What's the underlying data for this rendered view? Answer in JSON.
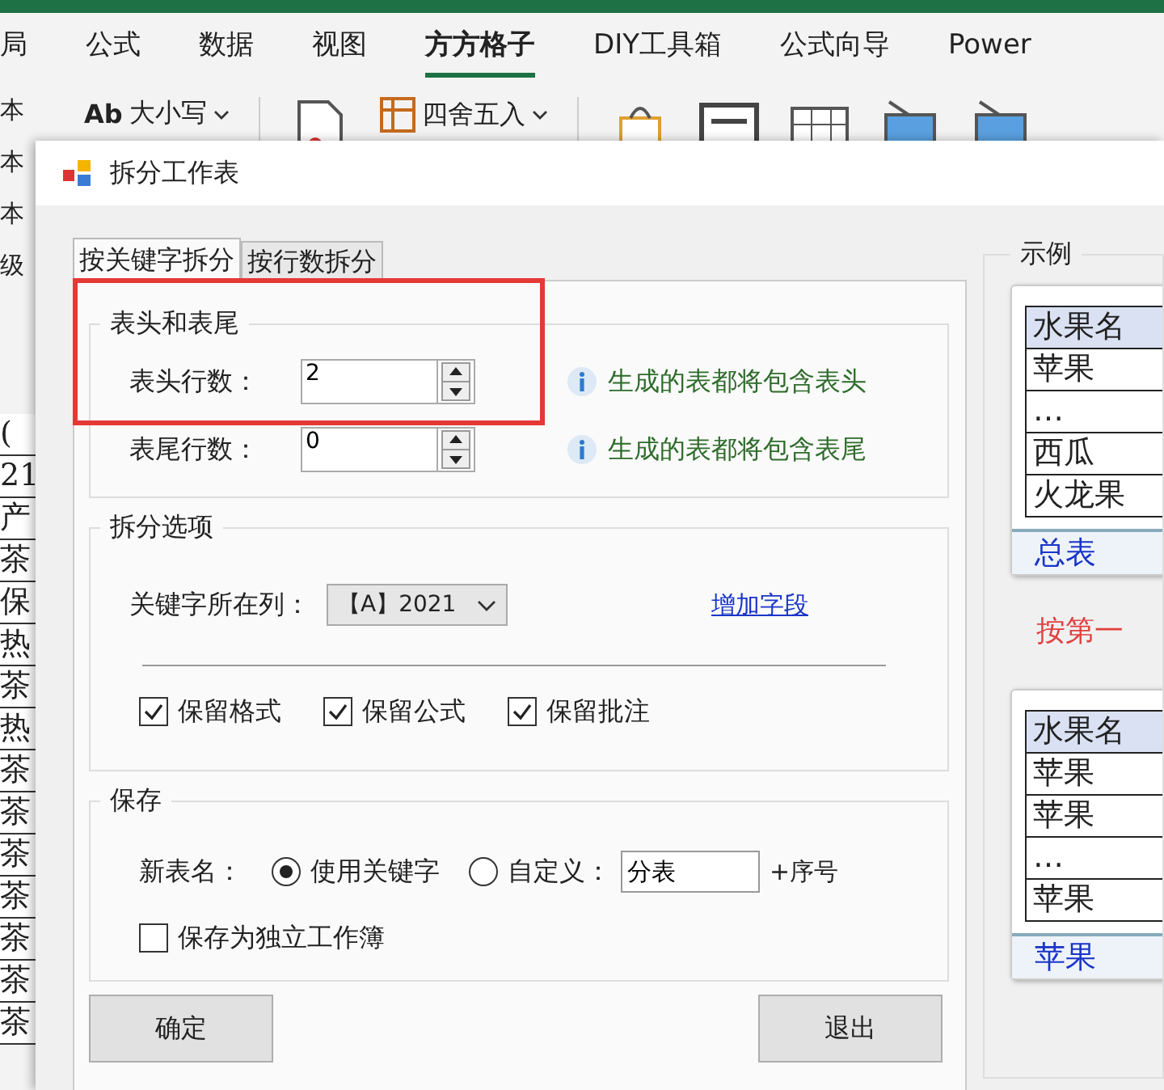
{
  "ribbon": {
    "tabs": [
      {
        "label": "局",
        "selected": false
      },
      {
        "label": "公式",
        "selected": false
      },
      {
        "label": "数据",
        "selected": false
      },
      {
        "label": "视图",
        "selected": false
      },
      {
        "label": "方方格子",
        "selected": true
      },
      {
        "label": "DIY工具箱",
        "selected": false
      },
      {
        "label": "公式向导",
        "selected": false
      },
      {
        "label": "Power",
        "selected": false
      }
    ],
    "toolbar": [
      {
        "kind": "text-dropdown",
        "icon": "Ab",
        "label": "大小写"
      },
      {
        "kind": "icon"
      },
      {
        "kind": "dropdown",
        "label": "四舍五入"
      },
      {
        "kind": "icon"
      },
      {
        "kind": "icon"
      },
      {
        "kind": "icon"
      },
      {
        "kind": "icon"
      },
      {
        "kind": "icon"
      }
    ]
  },
  "side_labels": [
    "本",
    "本",
    "本",
    "级"
  ],
  "sheet_cells": [
    "(",
    "21",
    "产",
    "茶",
    "保",
    "热",
    "茶",
    "热",
    "茶",
    "茶",
    "茶",
    "茶",
    "茶",
    "茶",
    "茶"
  ],
  "dialog": {
    "title": "拆分工作表",
    "tabs": [
      {
        "label": "按关键字拆分",
        "selected": true
      },
      {
        "label": "按行数拆分",
        "selected": false
      }
    ],
    "header_footer": {
      "title": "表头和表尾",
      "rows": [
        {
          "label": "表头行数：",
          "value": "2",
          "hint": "生成的表都将包含表头"
        },
        {
          "label": "表尾行数：",
          "value": "0",
          "hint": "生成的表都将包含表尾"
        }
      ]
    },
    "split_options": {
      "title": "拆分选项",
      "column_label": "关键字所在列：",
      "column_value": "【A】2021",
      "link": "增加字段",
      "checkboxes": [
        {
          "label": "保留格式",
          "checked": true
        },
        {
          "label": "保留公式",
          "checked": true
        },
        {
          "label": "保留批注",
          "checked": true
        }
      ]
    },
    "save": {
      "title": "保存",
      "name_label": "新表名：",
      "radios": [
        {
          "label": "使用关键字",
          "selected": true
        },
        {
          "label": "自定义：",
          "selected": false
        }
      ],
      "custom_value": "分表",
      "suffix": "+序号",
      "separate_workbook": {
        "label": "保存为独立工作簿",
        "checked": false
      }
    },
    "buttons": [
      "确定",
      "退出"
    ],
    "example": {
      "title": "示例",
      "sheets": [
        {
          "rows": [
            "水果名",
            "苹果",
            "…",
            "西瓜",
            "火龙果"
          ],
          "tabs": [
            "总表"
          ]
        },
        {
          "rows": [
            "水果名",
            "苹果",
            "苹果",
            "…",
            "苹果"
          ],
          "tabs": [
            "苹果"
          ]
        }
      ],
      "caption": "按第一"
    }
  }
}
